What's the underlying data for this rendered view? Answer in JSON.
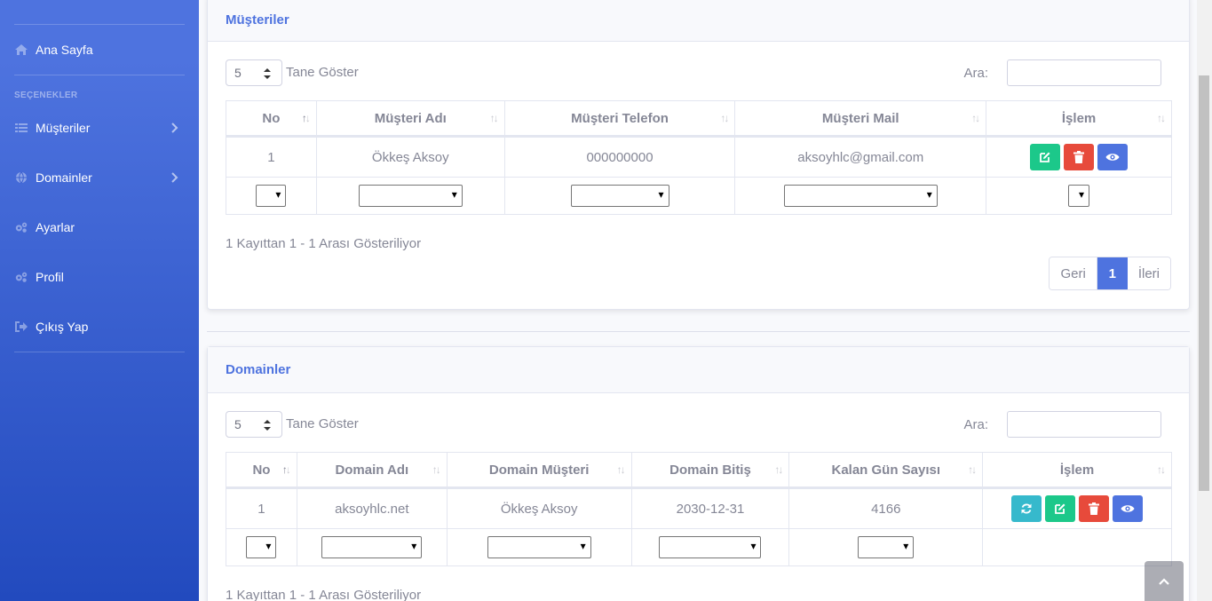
{
  "sidebar": {
    "heading": "SEÇENEKLER",
    "items": [
      {
        "label": "Ana Sayfa",
        "icon": "home-icon"
      },
      {
        "label": "Müşteriler",
        "icon": "list-icon"
      },
      {
        "label": "Domainler",
        "icon": "globe-icon"
      },
      {
        "label": "Ayarlar",
        "icon": "cogs-icon"
      },
      {
        "label": "Profil",
        "icon": "cogs-icon"
      },
      {
        "label": "Çıkış Yap",
        "icon": "sign-out-icon"
      }
    ]
  },
  "customers": {
    "title": "Müşteriler",
    "length_value": "5",
    "length_label": "Tane Göster",
    "search_label": "Ara:",
    "columns": [
      "No",
      "Müşteri Adı",
      "Müşteri Telefon",
      "Müşteri Mail",
      "İşlem"
    ],
    "rows": [
      {
        "no": "1",
        "name": "Ökkeş Aksoy",
        "phone": "000000000",
        "mail": "aksoyhlc@gmail.com"
      }
    ],
    "info": "1 Kayıttan 1 - 1 Arası Gösteriliyor",
    "pager": {
      "prev": "Geri",
      "current": "1",
      "next": "İleri"
    }
  },
  "domains": {
    "title": "Domainler",
    "length_value": "5",
    "length_label": "Tane Göster",
    "search_label": "Ara:",
    "columns": [
      "No",
      "Domain Adı",
      "Domain Müşteri",
      "Domain Bitiş",
      "Kalan Gün Sayısı",
      "İşlem"
    ],
    "rows": [
      {
        "no": "1",
        "domain": "aksoyhlc.net",
        "customer": "Ökkeş Aksoy",
        "end": "2030-12-31",
        "days": "4166"
      }
    ],
    "info": "1 Kayıttan 1 - 1 Arası Gösteriliyor"
  },
  "colors": {
    "primary": "#4e73df",
    "success": "#1cc88a",
    "danger": "#e74a3b",
    "info": "#36b9cc"
  }
}
